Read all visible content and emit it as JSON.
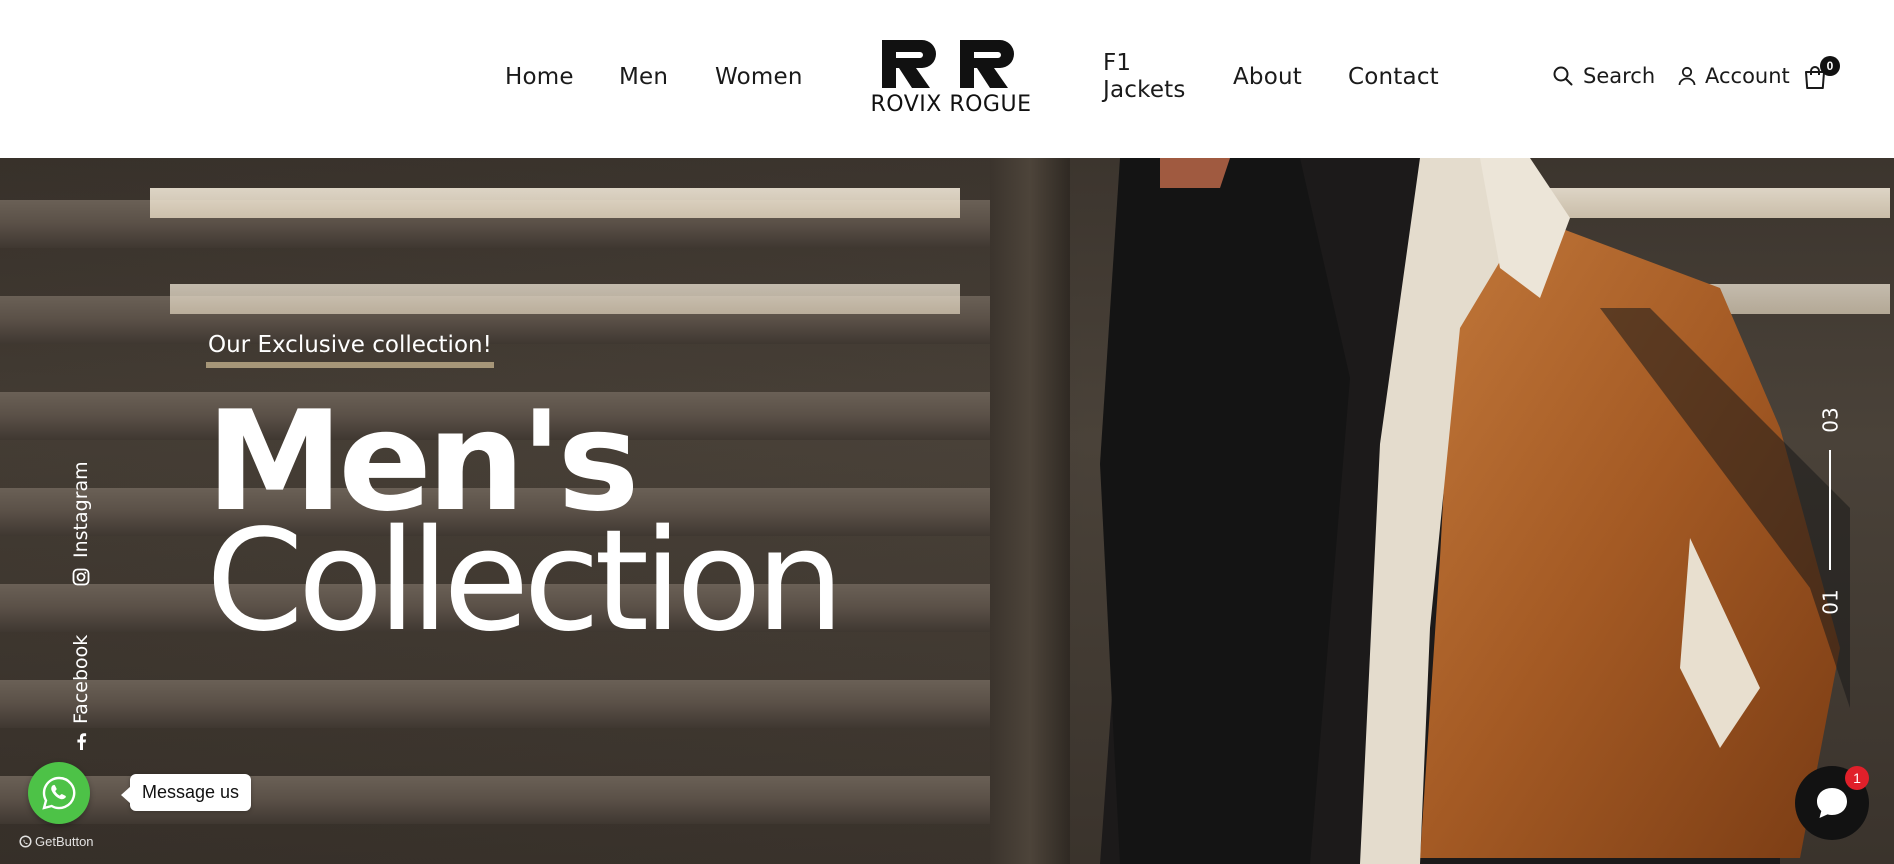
{
  "header": {
    "nav": {
      "home": "Home",
      "men": "Men",
      "women": "Women",
      "f1_jackets": "F1 Jackets",
      "about": "About",
      "contact": "Contact"
    },
    "logo": {
      "mark": "RR",
      "text": "ROVIX ROGUE"
    },
    "search_label": "Search",
    "account_label": "Account",
    "cart_count": "0"
  },
  "hero": {
    "tagline": "Our Exclusive collection!",
    "title_line1": "Men's",
    "title_line2": "Collection",
    "socials": {
      "instagram": "Instagram",
      "facebook": "Facebook"
    },
    "pager": {
      "current": "01",
      "total": "03"
    }
  },
  "widgets": {
    "whatsapp_label": "Message us",
    "getbutton": "GetButton",
    "chat_badge": "1"
  },
  "colors": {
    "whatsapp": "#4dc247",
    "chat_button": "#121212",
    "chat_badge": "#e0202a",
    "tagline_underline": "#d2be96"
  }
}
